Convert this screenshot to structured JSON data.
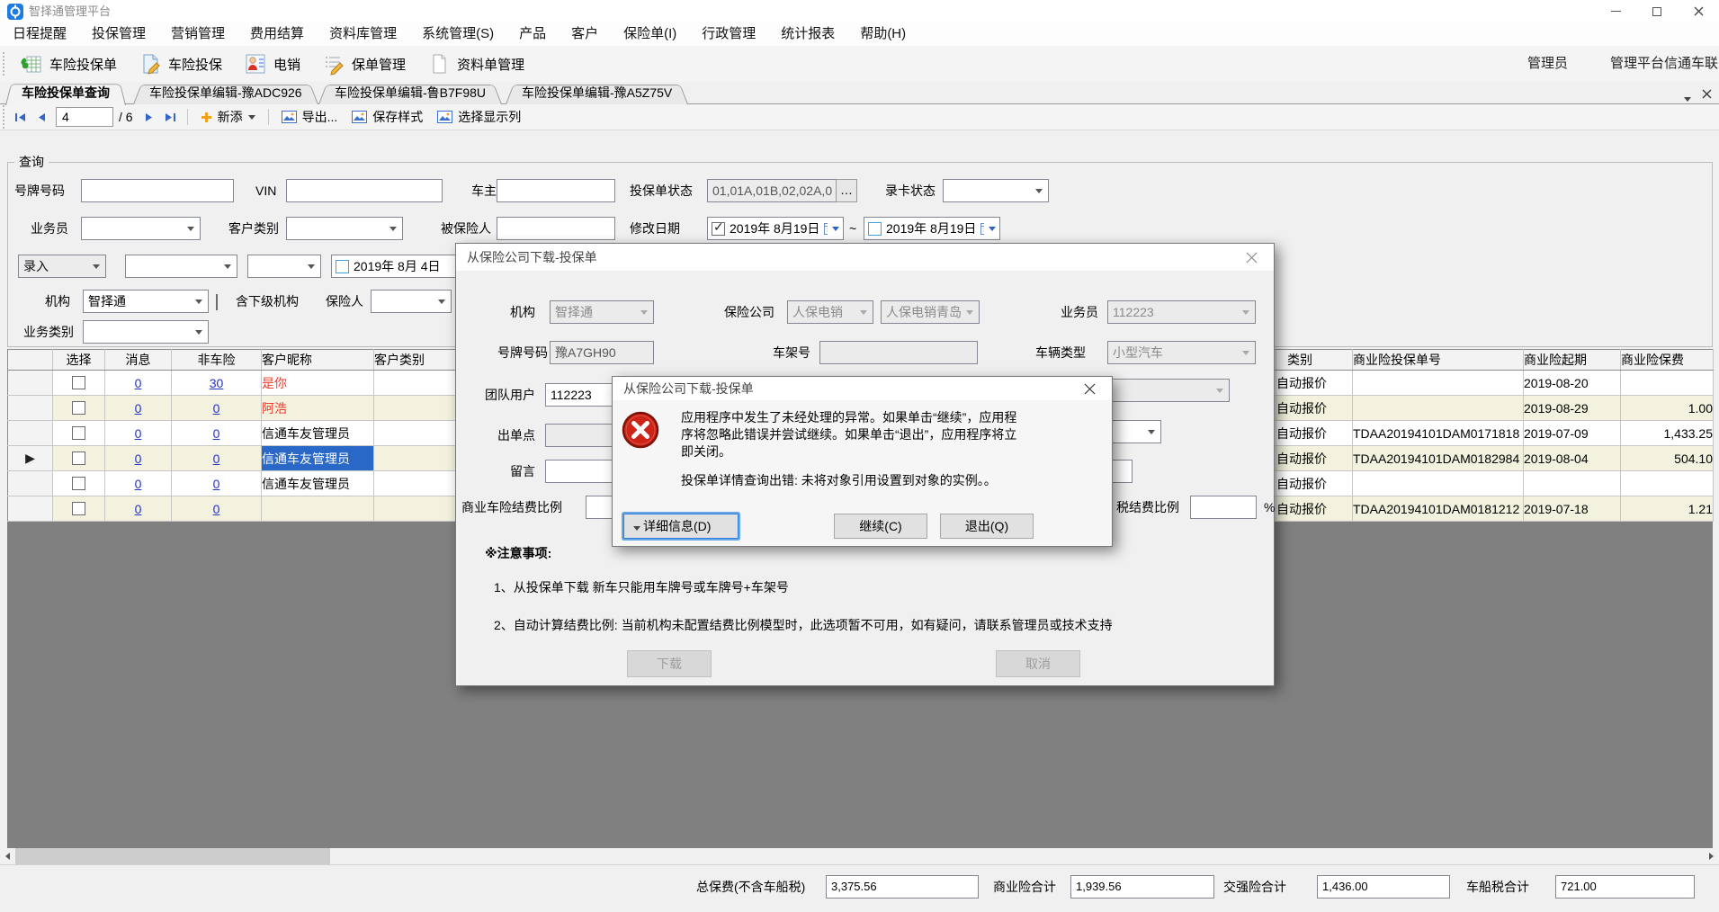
{
  "window": {
    "title": "智择通管理平台"
  },
  "menu": {
    "items": [
      "日程提醒",
      "投保管理",
      "营销管理",
      "费用结算",
      "资料库管理",
      "系统管理(S)",
      "产品",
      "客户",
      "保险单(I)",
      "行政管理",
      "统计报表",
      "帮助(H)"
    ]
  },
  "toolbar": {
    "items": [
      {
        "label": "车险投保单"
      },
      {
        "label": "车险投保"
      },
      {
        "label": "电销"
      },
      {
        "label": "保单管理"
      },
      {
        "label": "资料单管理"
      }
    ],
    "user_label": "管理员",
    "platform_label": "管理平台信通车联"
  },
  "tabs": [
    {
      "label": "车险投保单查询"
    },
    {
      "label": "车险投保单编辑-豫ADC926"
    },
    {
      "label": "车险投保单编辑-鲁B7F98U"
    },
    {
      "label": "车险投保单编辑-豫A5Z75V"
    }
  ],
  "record_nav": {
    "position": "4",
    "total": "/ 6",
    "add_label": "新添",
    "export_label": "导出...",
    "save_style_label": "保存样式",
    "columns_label": "选择显示列"
  },
  "query": {
    "group_title": "查询",
    "plate_label": "号牌号码",
    "vin_label": "VIN",
    "owner_label": "车主",
    "status_label": "投保单状态",
    "status_value": "01,01A,01B,02,02A,0",
    "status_more": "…",
    "card_status_label": "录卡状态",
    "salesman_label": "业务员",
    "customer_type_label": "客户类别",
    "insured_label": "被保险人",
    "modify_date_label": "修改日期",
    "date_from": "2019年 8月19日",
    "date_tilde": "~",
    "date_to": "2019年 8月19日",
    "entry_value": "录入",
    "entry_date": "2019年 8月 4日",
    "org_label": "机构",
    "org_value": "智择通",
    "include_sub_label": "含下级机构",
    "insurer_label": "保险人",
    "biz_type_label": "业务类别"
  },
  "grid": {
    "columns": {
      "select": "选择",
      "message": "消息",
      "non_auto": "非车险",
      "nickname": "客户昵称",
      "customer_type": "客户类别",
      "quote_type": "类别",
      "policy_no": "商业险投保单号",
      "start_date": "商业险起期",
      "premium": "商业险保费"
    },
    "rows": [
      {
        "message": "0",
        "non_auto": "30",
        "nickname": "是你",
        "quote_type": "自动报价",
        "policy_no": "",
        "start_date": "2019-08-20",
        "premium": ""
      },
      {
        "message": "0",
        "non_auto": "0",
        "nickname": "阿浩",
        "quote_type": "自动报价",
        "policy_no": "",
        "start_date": "2019-08-29",
        "premium": "1.00"
      },
      {
        "message": "0",
        "non_auto": "0",
        "nickname": "信通车友管理员",
        "quote_type": "自动报价",
        "policy_no": "TDAA20194101DAM0171818",
        "start_date": "2019-07-09",
        "premium": "1,433.25"
      },
      {
        "message": "0",
        "non_auto": "0",
        "nickname": "信通车友管理员",
        "quote_type": "自动报价",
        "policy_no": "TDAA20194101DAM0182984",
        "start_date": "2019-08-04",
        "premium": "504.10"
      },
      {
        "message": "0",
        "non_auto": "0",
        "nickname": "信通车友管理员",
        "quote_type": "自动报价",
        "policy_no": "",
        "start_date": "",
        "premium": ""
      },
      {
        "message": "0",
        "non_auto": "0",
        "nickname": "",
        "quote_type": "自动报价",
        "policy_no": "TDAA20194101DAM0181212",
        "start_date": "2019-07-18",
        "premium": "1.21"
      }
    ]
  },
  "download_dialog": {
    "title": "从保险公司下载-投保单",
    "org_label": "机构",
    "org_value": "智择通",
    "insurer_label": "保险公司",
    "insurer_value1": "人保电销",
    "insurer_value2": "人保电销青岛",
    "salesman_label": "业务员",
    "salesman_value": "112223",
    "plate_label": "号牌号码",
    "plate_value": "豫A7GH90",
    "frame_label": "车架号",
    "vehicle_type_label": "车辆类型",
    "vehicle_type_value": "小型汽车",
    "team_label": "团队用户",
    "team_value": "112223",
    "outlet_label": "出单点",
    "message_label": "留言",
    "commercial_ratio_label": "商业车险结费比例",
    "tax_ratio_label": "税结费比例",
    "percent": "%",
    "notes_title": "※注意事项:",
    "note1": "1、从投保单下载 新车只能用车牌号或车牌号+车架号",
    "note2": "2、自动计算结费比例: 当前机构未配置结费比例模型时，此选项暂不可用，如有疑问，请联系管理员或技术支持",
    "download_label": "下载",
    "cancel_label": "取消"
  },
  "error_dialog": {
    "title": "从保险公司下载-投保单",
    "message": "应用程序中发生了未经处理的异常。如果单击“继续”，应用程\n序将忽略此错误并尝试继续。如果单击“退出”，应用程序将立\n即关闭。",
    "detail": "投保单详情查询出错: 未将对象引用设置到对象的实例。。",
    "details_button": "详细信息(D)",
    "continue_button": "继续(C)",
    "quit_button": "退出(Q)"
  },
  "status_bar": {
    "total_label": "总保费(不含车船税)",
    "total_value": "3,375.56",
    "commercial_label": "商业险合计",
    "commercial_value": "1,939.56",
    "compulsory_label": "交强险合计",
    "compulsory_value": "1,436.00",
    "tax_label": "车船税合计",
    "tax_value": "721.00"
  },
  "icons": {
    "check": "✓",
    "row_arrow": "▶"
  },
  "colors": {
    "selection": "#2a68c8",
    "link": "#2233cc",
    "alert_red": "#ee3b2e",
    "error_icon": "#ce2418",
    "row_alt": "#f2f2de"
  }
}
